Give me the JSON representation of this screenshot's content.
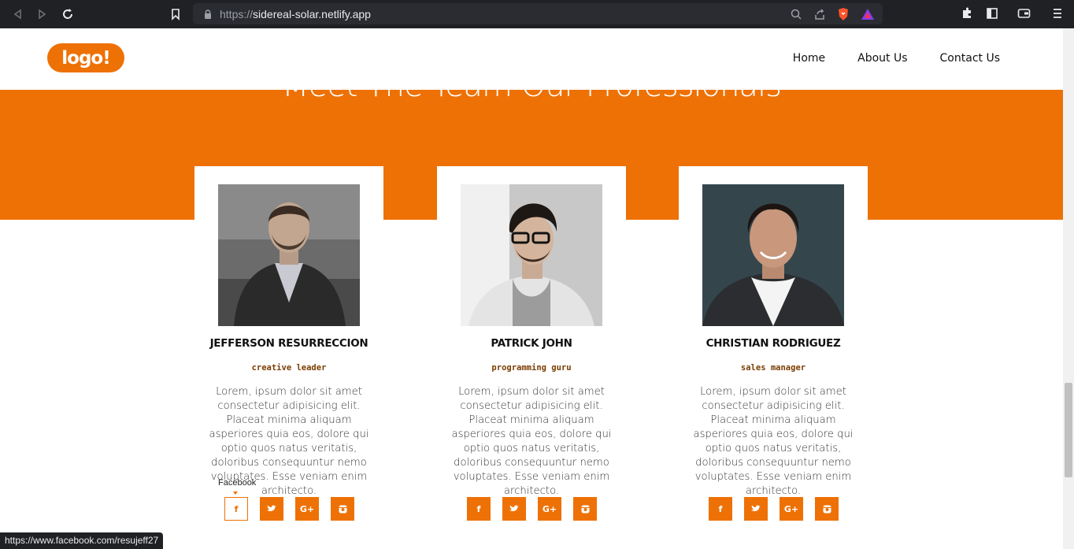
{
  "browser": {
    "url_scheme": "https://",
    "url_host": "sidereal-solar.netlify.app"
  },
  "header": {
    "logo_text": "logo!",
    "nav": [
      {
        "label": "Home"
      },
      {
        "label": "About Us"
      },
      {
        "label": "Contact Us"
      }
    ]
  },
  "section": {
    "title": "Meet The Team Our Professionals"
  },
  "team": [
    {
      "name": "JEFFERSON RESURRECCION",
      "role": "creative leader",
      "bio": "Lorem, ipsum dolor sit amet consectetur adipisicing elit. Placeat minima aliquam asperiores quia eos, dolore qui optio quos natus veritatis, doloribus consequuntur nemo voluptates. Esse veniam enim architecto."
    },
    {
      "name": "PATRICK JOHN",
      "role": "programming guru",
      "bio": "Lorem, ipsum dolor sit amet consectetur adipisicing elit. Placeat minima aliquam asperiores quia eos, dolore qui optio quos natus veritatis, doloribus consequuntur nemo voluptates. Esse veniam enim architecto."
    },
    {
      "name": "CHRISTIAN RODRIGUEZ",
      "role": "sales manager",
      "bio": "Lorem, ipsum dolor sit amet consectetur adipisicing elit. Placeat minima aliquam asperiores quia eos, dolore qui optio quos natus veritatis, doloribus consequuntur nemo voluptates. Esse veniam enim architecto."
    }
  ],
  "social_icons": [
    "f",
    "t",
    "G+",
    "ig"
  ],
  "tooltip": "Facebook",
  "status_url": "https://www.facebook.com/resujeff27",
  "colors": {
    "accent": "#ee7106",
    "role_text": "#7a3d00"
  }
}
